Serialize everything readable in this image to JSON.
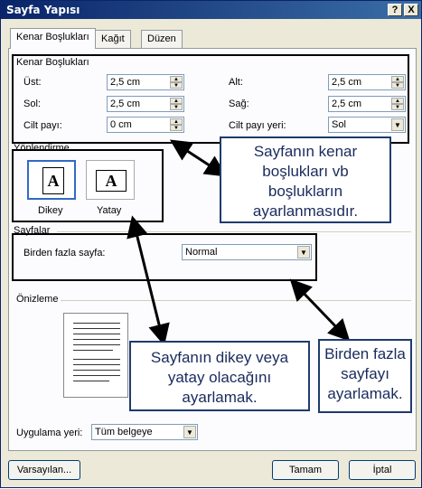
{
  "window": {
    "title": "Sayfa Yapısı",
    "help_button": "?",
    "close_button": "X"
  },
  "tabs": [
    {
      "label": "Kenar Boşlukları",
      "active": true
    },
    {
      "label": "Kağıt",
      "active": false
    },
    {
      "label": "Düzen",
      "active": false
    }
  ],
  "margins": {
    "group_label": "Kenar Boşlukları",
    "top_label": "Üst:",
    "top_value": "2,5 cm",
    "bottom_label": "Alt:",
    "bottom_value": "2,5 cm",
    "left_label": "Sol:",
    "left_value": "2,5 cm",
    "right_label": "Sağ:",
    "right_value": "2,5 cm",
    "gutter_label": "Cilt payı:",
    "gutter_value": "0 cm",
    "gutter_pos_label": "Cilt payı yeri:",
    "gutter_pos_value": "Sol"
  },
  "orientation": {
    "group_label": "Yönlendirme",
    "portrait_label": "Dikey",
    "landscape_label": "Yatay",
    "icon_letter": "A"
  },
  "pages": {
    "group_label": "Sayfalar",
    "multiple_label": "Birden fazla sayfa:",
    "multiple_value": "Normal"
  },
  "preview": {
    "group_label": "Önizleme",
    "apply_label": "Uygulama yeri:",
    "apply_value": "Tüm belgeye"
  },
  "buttons": {
    "default": "Varsayılan...",
    "ok": "Tamam",
    "cancel": "İptal"
  },
  "callouts": {
    "margins": "Sayfanın kenar boşlukları vb boşlukların ayarlanmasıdır.",
    "orientation": "Sayfanın dikey veya yatay olacağını ayarlamak.",
    "pages": "Birden fazla sayfayı ayarlamak."
  }
}
